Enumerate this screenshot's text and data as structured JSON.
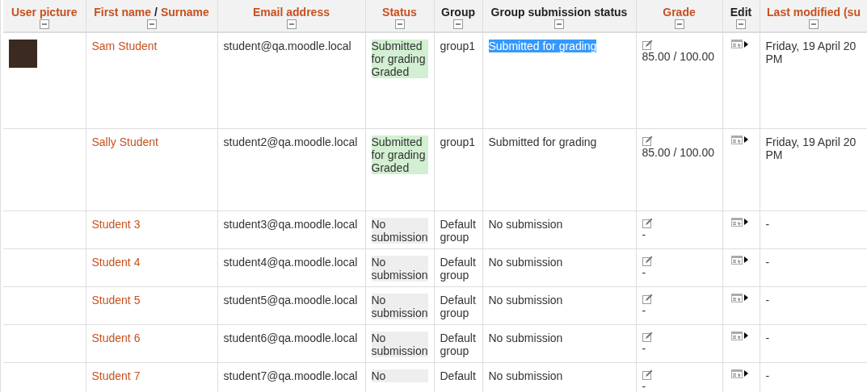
{
  "table": {
    "columns": [
      {
        "label": "User picture",
        "sortable": true
      },
      {
        "label": "First name",
        "separator": "/",
        "label_2": "Surname",
        "sortable": true
      },
      {
        "label": "Email address",
        "sortable": true
      },
      {
        "label": "Status",
        "sortable": true
      },
      {
        "label": "Group",
        "sortable": false
      },
      {
        "label": "Group submission status",
        "sortable": false
      },
      {
        "label": "Grade",
        "sortable": true
      },
      {
        "label": "Edit",
        "sortable": false
      },
      {
        "label": "Last modified (su",
        "sortable": true
      }
    ],
    "rows": [
      {
        "has_picture": true,
        "name": "Sam Student",
        "email": "student@qa.moodle.local",
        "status": {
          "kind": "submitted",
          "lines": [
            "Submitted for grading",
            "Graded"
          ]
        },
        "group": "group1",
        "group_status": {
          "text": "Submitted for grading",
          "highlighted": true
        },
        "grade": "85.00 / 100.00",
        "last_modified": [
          "Friday, 19 April 20",
          "PM"
        ]
      },
      {
        "has_picture": false,
        "name": "Sally Student",
        "email": "student2@qa.moodle.local",
        "status": {
          "kind": "submitted",
          "lines": [
            "Submitted for grading",
            "Graded"
          ]
        },
        "group": "group1",
        "group_status": {
          "text": "Submitted for grading",
          "highlighted": false
        },
        "grade": "85.00 / 100.00",
        "last_modified": [
          "Friday, 19 April 20",
          "PM"
        ]
      },
      {
        "has_picture": false,
        "name": "Student 3",
        "email": "student3@qa.moodle.local",
        "status": {
          "kind": "none",
          "lines": [
            "No submission"
          ]
        },
        "group": "Default group",
        "group_status": {
          "text": "No submission",
          "highlighted": false
        },
        "grade": "-",
        "last_modified": [
          "-"
        ]
      },
      {
        "has_picture": false,
        "name": "Student 4",
        "email": "student4@qa.moodle.local",
        "status": {
          "kind": "none",
          "lines": [
            "No submission"
          ]
        },
        "group": "Default group",
        "group_status": {
          "text": "No submission",
          "highlighted": false
        },
        "grade": "-",
        "last_modified": [
          "-"
        ]
      },
      {
        "has_picture": false,
        "name": "Student 5",
        "email": "student5@qa.moodle.local",
        "status": {
          "kind": "none",
          "lines": [
            "No submission"
          ]
        },
        "group": "Default group",
        "group_status": {
          "text": "No submission",
          "highlighted": false
        },
        "grade": "-",
        "last_modified": [
          "-"
        ]
      },
      {
        "has_picture": false,
        "name": "Student 6",
        "email": "student6@qa.moodle.local",
        "status": {
          "kind": "none",
          "lines": [
            "No submission"
          ]
        },
        "group": "Default group",
        "group_status": {
          "text": "No submission",
          "highlighted": false
        },
        "grade": "-",
        "last_modified": [
          "-"
        ]
      },
      {
        "has_picture": false,
        "name": "Student 7",
        "email": "student7@qa.moodle.local",
        "status": {
          "kind": "none",
          "lines": [
            "No"
          ]
        },
        "group": "Default",
        "group_status": {
          "text": "No submission",
          "highlighted": false
        },
        "grade": "-",
        "last_modified": [
          "-"
        ]
      }
    ]
  }
}
